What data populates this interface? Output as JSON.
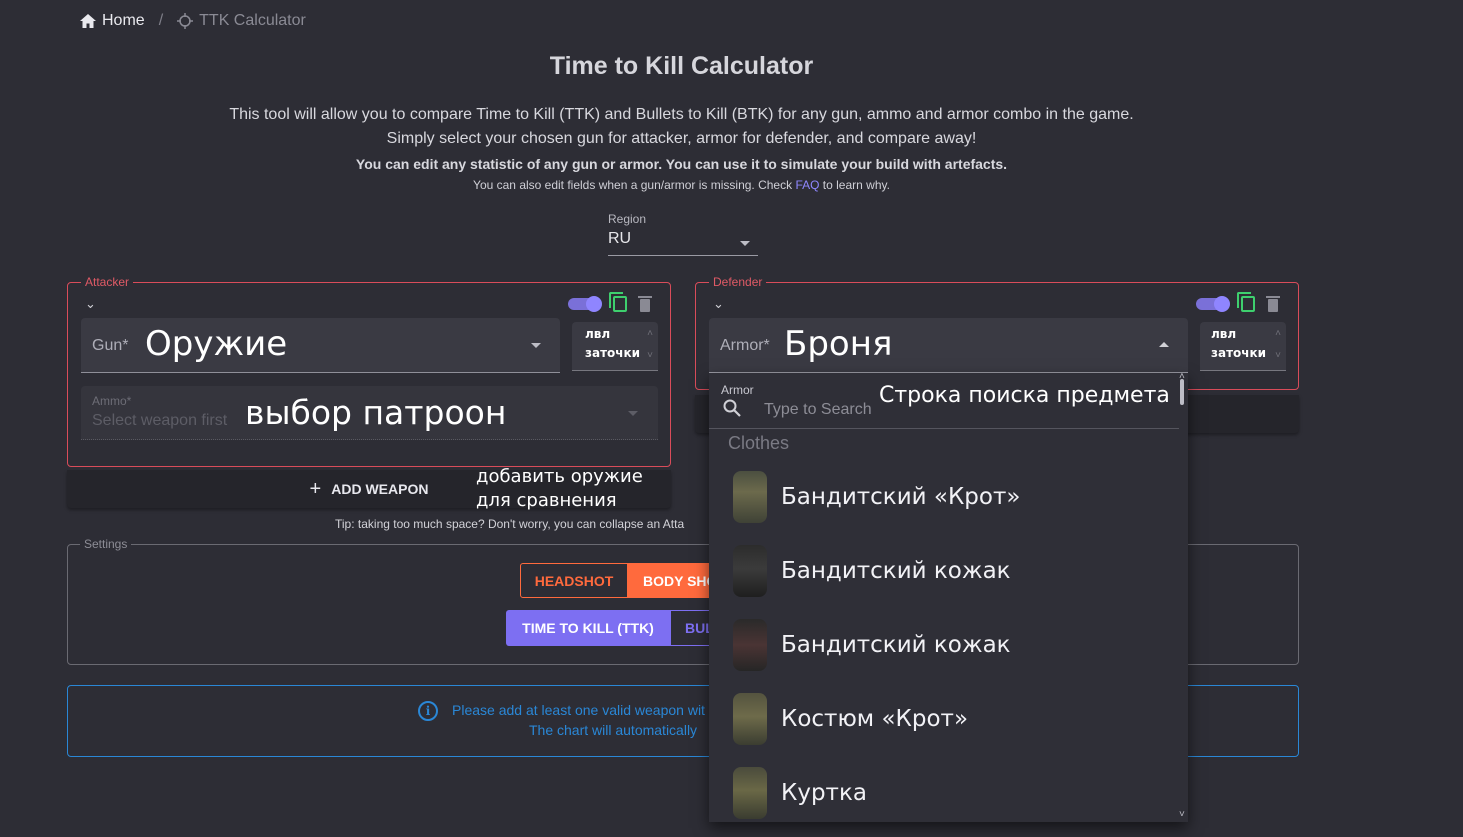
{
  "breadcrumb": {
    "home": "Home",
    "separator": "/",
    "current": "TTK Calculator"
  },
  "header": {
    "title": "Time to Kill Calculator",
    "line1": "This tool will allow you to compare Time to Kill (TTK) and Bullets to Kill (BTK) for any gun, ammo and armor combo in the game.",
    "line2": "Simply select your chosen gun for attacker, armor for defender, and compare away!",
    "line3": "You can edit any statistic of any gun or armor. You can use it to simulate your build with artefacts.",
    "line4_pre": "You can also edit fields when a gun/armor is missing. Check ",
    "line4_link": "FAQ",
    "line4_post": " to learn why."
  },
  "region": {
    "label": "Region",
    "value": "RU"
  },
  "attacker": {
    "legend": "Attacker",
    "gun_label": "Gun*",
    "gun_annotation": "Оружие",
    "level_label_1": "лвл",
    "level_label_2": "заточки",
    "ammo_label": "Ammo*",
    "ammo_placeholder": "Select weapon first",
    "ammo_annotation": "выбор патроон",
    "add_weapon": "ADD WEAPON",
    "add_weapon_annotation_1": "добавить оружие",
    "add_weapon_annotation_2": "для сравнения"
  },
  "defender": {
    "legend": "Defender",
    "armor_label": "Armor*",
    "armor_annotation": "Броня",
    "level_label_1": "лвл",
    "level_label_2": "заточки"
  },
  "tip": "Tip: taking too much space? Don't worry, you can collapse an Atta",
  "settings": {
    "legend": "Settings",
    "headshot": "HEADSHOT",
    "bodyshot": "BODY SHO",
    "ttk": "TIME TO KILL (TTK)",
    "btk": "BUL"
  },
  "info": {
    "line1": "Please add at least one valid weapon wit",
    "line2": "The chart will automatically"
  },
  "dropdown": {
    "search_label": "Armor",
    "search_placeholder": "Type to Search",
    "search_annotation": "Строка поиска предмета",
    "group": "Clothes",
    "items": [
      {
        "name": "Бандитский «Крот»"
      },
      {
        "name": "Бандитский кожак"
      },
      {
        "name": "Бандитский кожак"
      },
      {
        "name": "Костюм «Крот»"
      },
      {
        "name": "Куртка"
      }
    ]
  },
  "colors": {
    "background": "#2d2d35",
    "attacker_border": "#d94c5a",
    "accent_orange": "#ff6a3d",
    "accent_purple": "#7d6ff2",
    "info_blue": "#2a87d6",
    "copy_green": "#3ecf6e"
  }
}
